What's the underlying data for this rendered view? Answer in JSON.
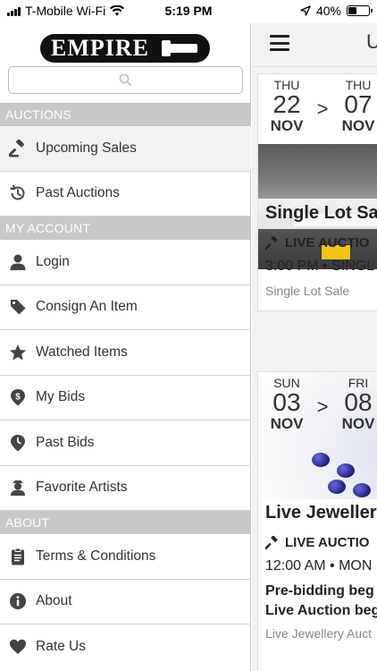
{
  "status_bar": {
    "carrier": "T-Mobile Wi-Fi",
    "time": "5:19 PM",
    "battery": "40%",
    "battery_level": 0.4
  },
  "drawer": {
    "logo_text": "EMPIRE",
    "search": {
      "placeholder": "",
      "value": ""
    },
    "sections": [
      {
        "title": "AUCTIONS",
        "items": [
          {
            "label": "Upcoming Sales",
            "icon": "gavel-icon"
          },
          {
            "label": "Past Auctions",
            "icon": "history-icon"
          }
        ]
      },
      {
        "title": "MY ACCOUNT",
        "items": [
          {
            "label": "Login",
            "icon": "user-icon"
          },
          {
            "label": "Consign An Item",
            "icon": "tag-icon"
          },
          {
            "label": "Watched Items",
            "icon": "star-icon"
          },
          {
            "label": "My Bids",
            "icon": "dollar-pin-icon"
          },
          {
            "label": "Past Bids",
            "icon": "clock-pin-icon"
          },
          {
            "label": "Favorite Artists",
            "icon": "artist-icon"
          }
        ]
      },
      {
        "title": "ABOUT",
        "items": [
          {
            "label": "Terms & Conditions",
            "icon": "clipboard-icon"
          },
          {
            "label": "About",
            "icon": "info-icon"
          },
          {
            "label": "Rate Us",
            "icon": "heart-icon"
          }
        ]
      }
    ]
  },
  "main": {
    "header_partial": "U",
    "cards": [
      {
        "start": {
          "dow": "THU",
          "day": "22",
          "month": "NOV"
        },
        "end": {
          "dow": "THU",
          "day": "07",
          "month": "NOV"
        },
        "separator": ">",
        "title": "Single Lot Sa",
        "live_label": "LIVE AUCTIO",
        "time_line": "3:00 PM • SINGL",
        "subtitle": "Single Lot Sale"
      },
      {
        "start": {
          "dow": "SUN",
          "day": "03",
          "month": "NOV"
        },
        "end": {
          "dow": "FRI",
          "day": "08",
          "month": "NOV"
        },
        "separator": ">",
        "title": "Live Jewellery",
        "live_label": "LIVE AUCTIO",
        "time_line": "12:00 AM • MON",
        "bold_line_1": "Pre-bidding beg",
        "bold_line_2": "Live Auction beg",
        "subtitle": "Live Jewellery Auct"
      }
    ]
  },
  "colors": {
    "section_header_bg": "#c8c8c8",
    "active_item_bg": "#f2f2f2",
    "icon_color": "#444444",
    "main_bg": "#f2f2f2"
  }
}
